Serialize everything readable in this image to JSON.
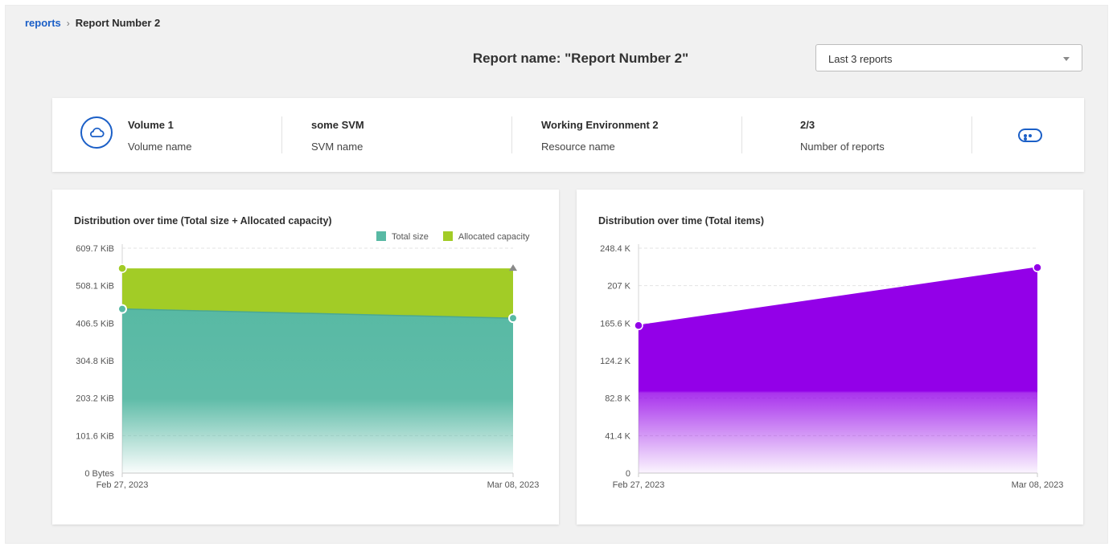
{
  "breadcrumb": {
    "parent": "reports",
    "separator": "›",
    "current": "Report Number 2"
  },
  "header": {
    "title": "Report name: \"Report Number 2\""
  },
  "report_select": {
    "value": "Last 3 reports"
  },
  "info": {
    "volume_value": "Volume 1",
    "volume_label": "Volume name",
    "svm_value": "some SVM",
    "svm_label": "SVM name",
    "resource_value": "Working Environment 2",
    "resource_label": "Resource name",
    "reports_value": "2/3",
    "reports_label": "Number of reports",
    "icons": {
      "volume": "cloud-icon",
      "more": "more-dots-icon"
    }
  },
  "colors": {
    "accent": "#1b5fc7",
    "total_size": "#58b9a4",
    "allocated": "#a2cc26",
    "items": "#9300e8"
  },
  "chart_data": [
    {
      "type": "area",
      "title": "Distribution over time (Total size + Allocated capacity)",
      "x": [
        "Feb 27, 2023",
        "Mar 08, 2023"
      ],
      "y_ticks": [
        "0 Bytes",
        "101.6 KiB",
        "203.2 KiB",
        "304.8 KiB",
        "406.5 KiB",
        "508.1 KiB",
        "609.7 KiB"
      ],
      "ylim": [
        0,
        609.7
      ],
      "y_unit": "KiB",
      "stacked": true,
      "legend_position": "top-right",
      "grid": true,
      "series": [
        {
          "name": "Total size",
          "values": [
            445,
            420
          ],
          "color": "#58b9a4"
        },
        {
          "name": "Allocated capacity",
          "values": [
            110,
            135
          ],
          "color": "#a2cc26"
        }
      ]
    },
    {
      "type": "area",
      "title": "Distribution over time (Total items)",
      "x": [
        "Feb 27, 2023",
        "Mar 08, 2023"
      ],
      "y_ticks": [
        "0",
        "41.4 K",
        "82.8 K",
        "124.2 K",
        "165.6 K",
        "207 K",
        "248.4 K"
      ],
      "ylim": [
        0,
        248.4
      ],
      "y_unit": "K",
      "grid": true,
      "series": [
        {
          "values": [
            163,
            227
          ],
          "color": "#9300e8"
        }
      ]
    }
  ]
}
